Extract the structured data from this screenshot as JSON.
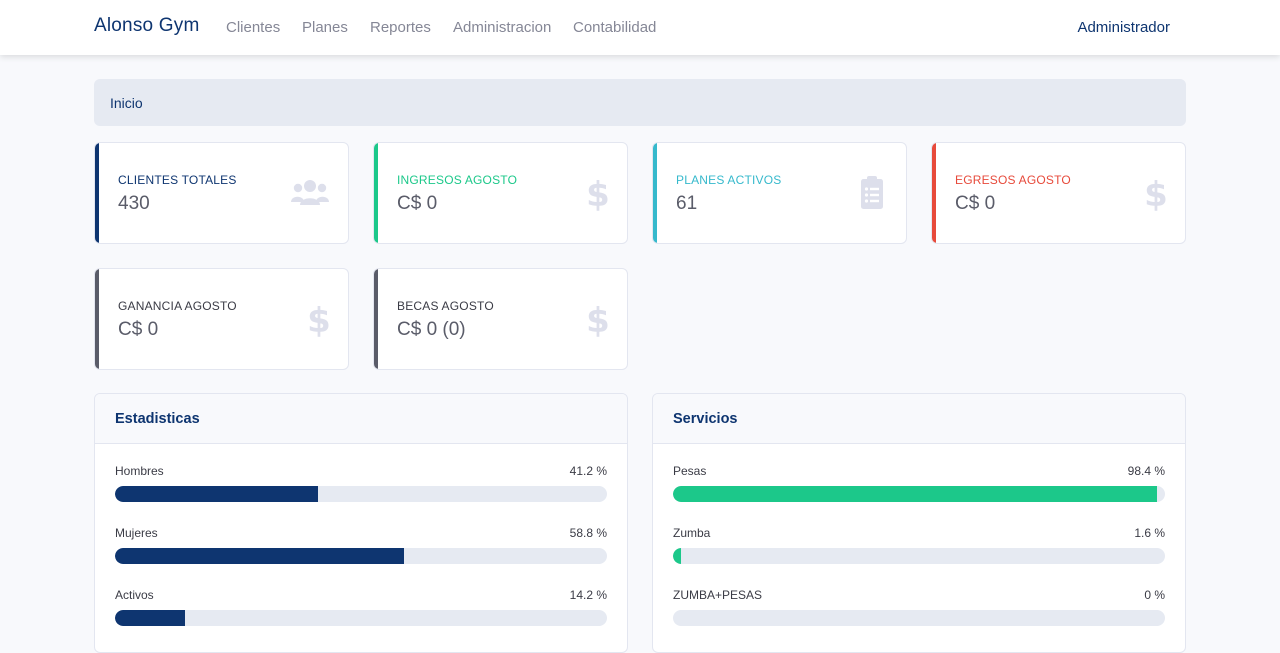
{
  "navbar": {
    "brand": "Alonso Gym",
    "links": [
      "Clientes",
      "Planes",
      "Reportes",
      "Administracion",
      "Contabilidad"
    ],
    "user": "Administrador"
  },
  "breadcrumb": {
    "current": "Inicio"
  },
  "cards": [
    {
      "label": "CLIENTES TOTALES",
      "value": "430",
      "icon": "users-icon",
      "color": "#0e3570",
      "labelColor": "#0e3570"
    },
    {
      "label": "INGRESOS AGOSTO",
      "value": "C$ 0",
      "icon": "dollar-icon",
      "color": "#1cc88a",
      "labelColor": "#1cc88a"
    },
    {
      "label": "PLANES ACTIVOS",
      "value": "61",
      "icon": "clipboard-list-icon",
      "color": "#36b9cc",
      "labelColor": "#36b9cc"
    },
    {
      "label": "EGRESOS AGOSTO",
      "value": "C$ 0",
      "icon": "dollar-icon",
      "color": "#e74a3b",
      "labelColor": "#e74a3b"
    },
    {
      "label": "GANANCIA AGOSTO",
      "value": "C$ 0",
      "icon": "dollar-icon",
      "color": "#5a5c69",
      "labelColor": "#3a3b45"
    },
    {
      "label": "BECAS AGOSTO",
      "value": "C$ 0 (0)",
      "icon": "dollar-icon",
      "color": "#5a5c69",
      "labelColor": "#3a3b45"
    }
  ],
  "estadisticas": {
    "title": "Estadisticas",
    "color": "#0e3570",
    "items": [
      {
        "label": "Hombres",
        "pct_text": "41.2 %",
        "value": 41.2
      },
      {
        "label": "Mujeres",
        "pct_text": "58.8 %",
        "value": 58.8
      },
      {
        "label": "Activos",
        "pct_text": "14.2 %",
        "value": 14.2
      }
    ]
  },
  "servicios": {
    "title": "Servicios",
    "color": "#1cc88a",
    "items": [
      {
        "label": "Pesas",
        "pct_text": "98.4 %",
        "value": 98.4
      },
      {
        "label": "Zumba",
        "pct_text": "1.6 %",
        "value": 1.6
      },
      {
        "label": "ZUMBA+PESAS",
        "pct_text": "0 %",
        "value": 0
      }
    ]
  }
}
